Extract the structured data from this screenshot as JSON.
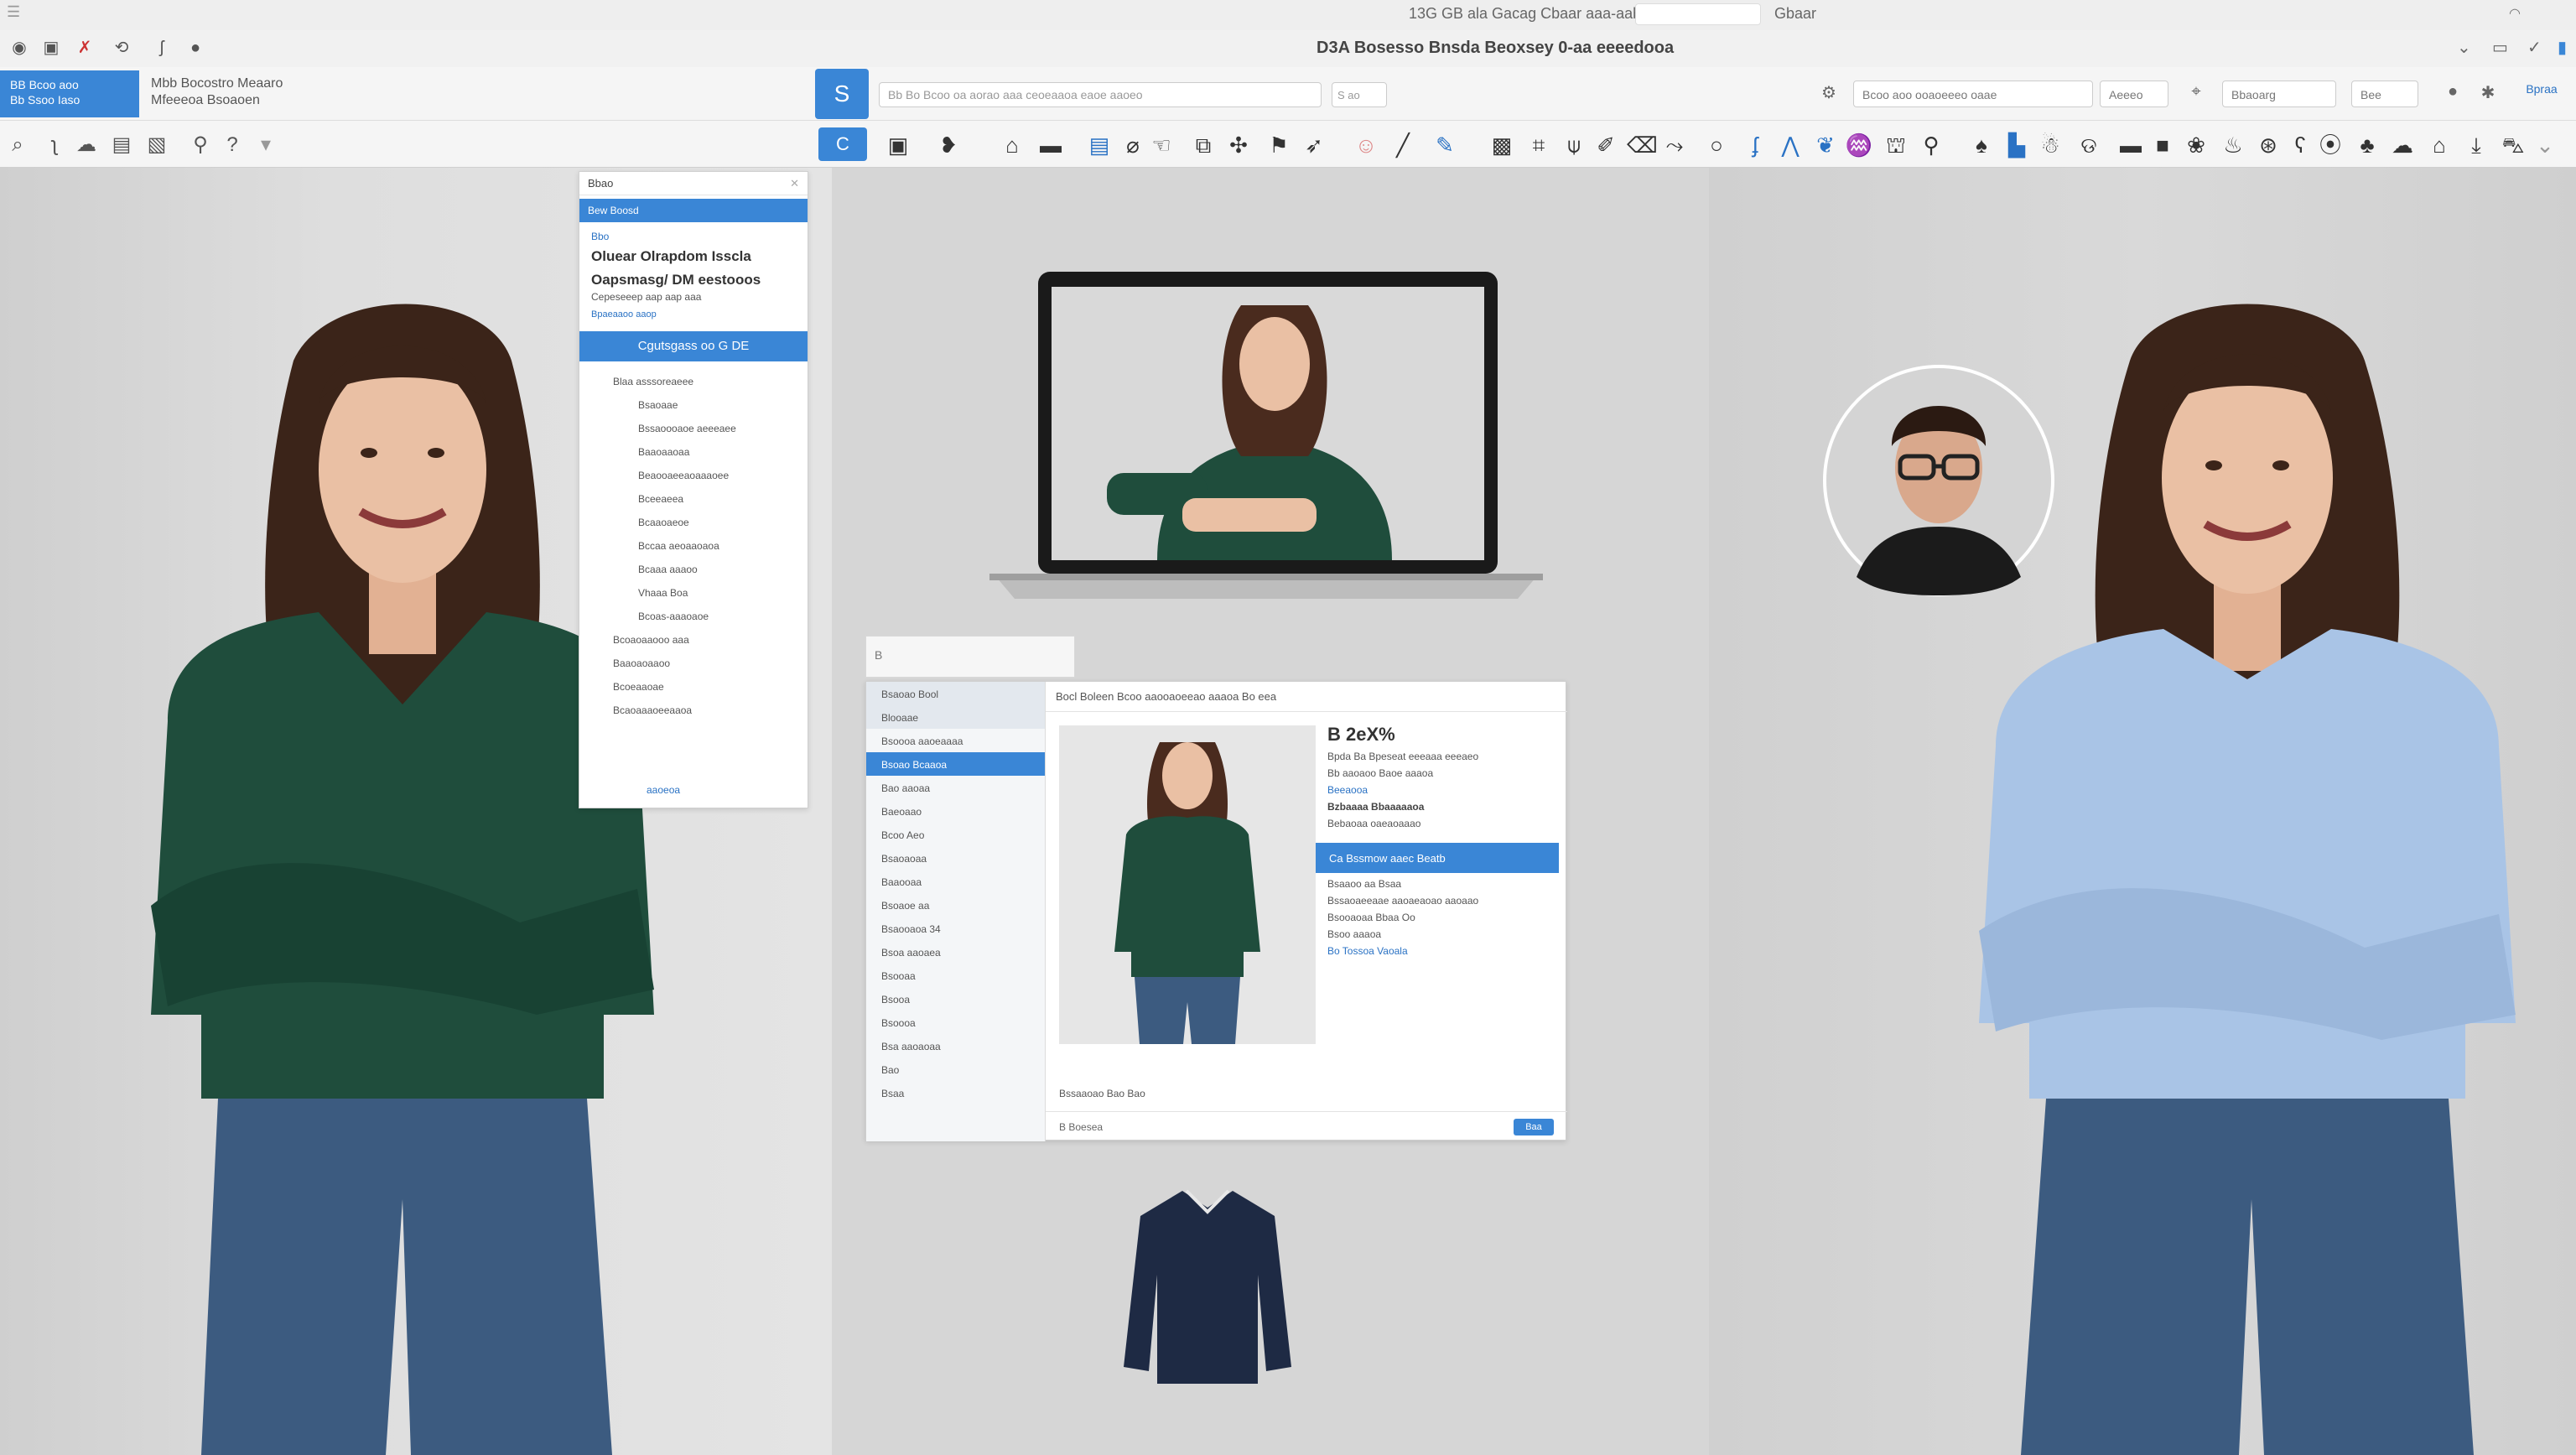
{
  "titlebar": {
    "title": "13G GB ala Gacag Cbaar aaa-aab",
    "right_label": "Gbaar"
  },
  "toolbar_row1": {
    "document_title": "D3A Bosesso Bnsda Beoxsey 0-aa eeeedooa",
    "icons": [
      "record-icon",
      "lock-icon",
      "share-icon",
      "crop-icon",
      "brush-icon",
      "circle-icon"
    ]
  },
  "toolbar_row2": {
    "account_box_line1": "BB Bcoo aoo",
    "account_box_line2": "Bb Ssoo Iaso",
    "info_line1": "Mbb Bocostro Meaaro",
    "info_line2": "Mfeeeoa Bsoaoen",
    "s_button": "S",
    "search_placeholder": "Bb Bo Bcoo oa aorao aaa ceoeaaoa eaoe aaoeo",
    "search_chip": "S ao",
    "right_field1": "Bcoo aoo ooaoeeeo oaae",
    "right_field2": "Aeeeo",
    "right_field3": "Bbaoarg",
    "right_field4": "Bee",
    "right_label": "Bpraa"
  },
  "toolbar_row3": {
    "c_button": "C"
  },
  "side_panel": {
    "header": "Bbao",
    "selected": "Bew Boosd",
    "small": "Bbo",
    "title_line1": "Oluear Olrapdom Isscla",
    "title_line2": "Oapsmasg/ DM eestooos",
    "subtitle": "Cepeseeep aap aap aaa",
    "link": "Bpaeaaoo aaop",
    "button": "Cgutsgass oo   G DE",
    "items": [
      "Blaa asssoreaeee",
      "Bsaoaae",
      "Bssaoooaoe aeeeaee",
      "Baaoaaoaa",
      "Beaooaeeaoaaaoee",
      "Bceeaeea",
      "Bcaaoaeoe",
      "Bccaa aeoaaoaoa",
      "Bcaaa aaaoo",
      "Vhaaa Boa",
      "Bcoas-aaaoaoe",
      "Bcoaoaaooo aaa",
      "Baaoaoaaoo",
      "Bcoeaaoae",
      "Bcaoaaaoeeaaoa"
    ],
    "footer": "aaoeoa"
  },
  "mini_app": {
    "tab_label": "B",
    "side_items": [
      "Bsaoao Bool",
      "Blooaae",
      "Bsoooa aaoeaaaa",
      "Bsoao Bcaaoa",
      "Bao aaoaa",
      "Baeoaao",
      "Bcoo Aeo",
      "Bsaoaoaa",
      "Baaooaa",
      "Bsoaoe aa",
      "Bsaooaoa 34",
      "Bsoa aaoaea",
      "Bsooaa",
      "Bsooa",
      "Bsoooa",
      "Bsa aaoaoaa",
      "Bao",
      "Bsaa"
    ],
    "top_bar": "Bocl Boleen   Bcoo aaooaoeeao aaaoa Bo eea",
    "price": "B 2eX%",
    "detail_lines": [
      "Bpda Ba Bpeseat eeeaaa eeeaeo",
      "Bb aaoaoo  Baoe aaaoa",
      "Beeaooa",
      "Bzbaaaa Bbaaaaaoa",
      "Bebaoaa oaeaoaaao",
      "Bsaaoo aa Bsaa",
      "Bssaoaeeaae aaoaeaoao aaoaao",
      "Bsooaoaa Bbaa Oo",
      "Bsoo aaaoa",
      "Bo Tossoa Vaoala"
    ],
    "select_label": "Ca Bssmow aaec Beatb",
    "bottom_links": "Bssaaoao  Bao  Bao",
    "status_text": "B  Boesea",
    "go_label": "Baa"
  },
  "colors": {
    "accent": "#3a86d6",
    "toolbar": "#f5f5f5",
    "canvas": "#dcdcdc",
    "green_top": "#1f4d3c",
    "blue_shirt": "#a9c4e6",
    "denim": "#3c5b80",
    "navy": "#1e2a44"
  }
}
